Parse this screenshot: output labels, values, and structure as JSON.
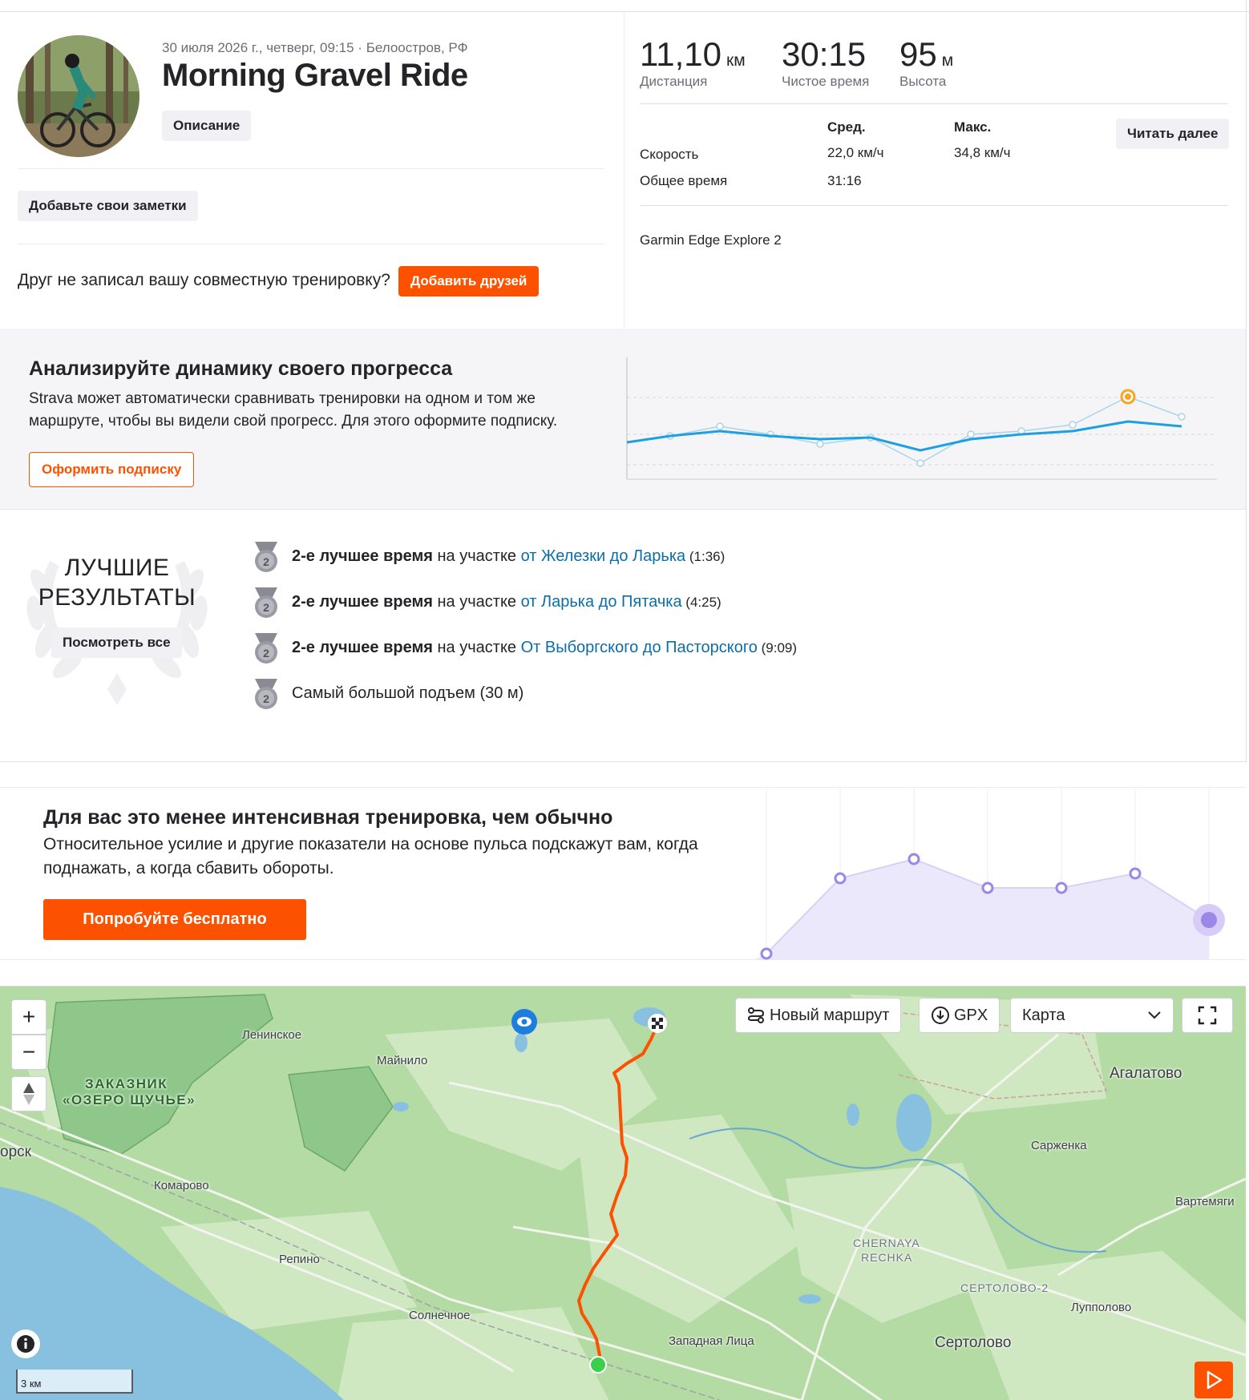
{
  "activity": {
    "meta": "30 июля 2026 г., четверг, 09:15 · Белоостров, РФ",
    "title": "Morning Gravel Ride",
    "description_button": "Описание",
    "notes_button": "Добавьте свои заметки",
    "friend_question": "Друг не записал вашу совместную тренировку?",
    "add_friends_button": "Добавить друзей"
  },
  "stats": {
    "distance": {
      "value": "11,10",
      "unit": "км",
      "label": "Дистанция"
    },
    "moving_time": {
      "value": "30:15",
      "label": "Чистое время"
    },
    "elevation": {
      "value": "95",
      "unit": "м",
      "label": "Высота"
    },
    "col_avg": "Сред.",
    "col_max": "Макс.",
    "read_more": "Читать далее",
    "rows": [
      {
        "label": "Скорость",
        "avg": "22,0 км/ч",
        "max": "34,8 км/ч"
      },
      {
        "label": "Общее время",
        "avg": "31:16",
        "max": ""
      }
    ],
    "device": "Garmin Edge Explore 2"
  },
  "progress": {
    "title": "Анализируйте динамику своего прогресса",
    "text": "Strava может автоматически сравнивать тренировки на одном и том же маршруте, чтобы вы видели свой прогресс. Для этого оформите подписку.",
    "subscribe_button": "Оформить подписку",
    "accent_color": "#fc5200",
    "line_color": "#1ea0e0"
  },
  "best": {
    "title_line1": "ЛУЧШИЕ",
    "title_line2": "РЕЗУЛЬТАТЫ",
    "see_all": "Посмотреть все",
    "medal_rank": "2",
    "items": [
      {
        "bold": "2-е лучшее время",
        "mid": " на участке ",
        "link": "от Железки до Ларька",
        "time": " (1:36)"
      },
      {
        "bold": "2-е лучшее время",
        "mid": " на участке ",
        "link": "от Ларька до Пятачка",
        "time": " (4:25)"
      },
      {
        "bold": "2-е лучшее время",
        "mid": " на участке ",
        "link": "От Выборгского до Пасторского",
        "time": " (9:09)"
      },
      {
        "bold": "",
        "mid": "Самый большой подъем",
        "link": "",
        "time": "  (30 м)"
      }
    ]
  },
  "intensity": {
    "title": "Для вас это менее интенсивная тренировка, чем обычно",
    "text": "Относительное усилие и другие показатели на основе пульса подскажут вам, когда поднажать, а когда сбавить обороты.",
    "try_button": "Попробуйте бесплатно",
    "chart_color": "#9b87e8"
  },
  "map": {
    "zoom_in": "+",
    "zoom_out": "−",
    "new_route": "Новый маршрут",
    "gpx": "GPX",
    "layer": "Карта",
    "scale": "3 км",
    "route_color": "#fc5200",
    "labels": {
      "leninskoe": "Ленинское",
      "mainilo": "Майнило",
      "zakaznik1": "ЗАКАЗНИК",
      "zakaznik2": "«ОЗЕРО ЩУЧЬЕ»",
      "zelenogorsk": "орск",
      "komarovo": "Комарово",
      "repino": "Репино",
      "solnechnoe": "Солнечное",
      "zapadnaya": "Западная Лица",
      "sertolovo": "Сертолово",
      "sertolovo2": "СЕРТОЛОВО-2",
      "lupolovo": "Лупполово",
      "chernaya1": "CHERNAYA",
      "chernaya2": "RECHKA",
      "vartemyagi": "Вартемяги",
      "sarzhenka": "Сарженка",
      "agalatovo": "Агалатово"
    }
  }
}
